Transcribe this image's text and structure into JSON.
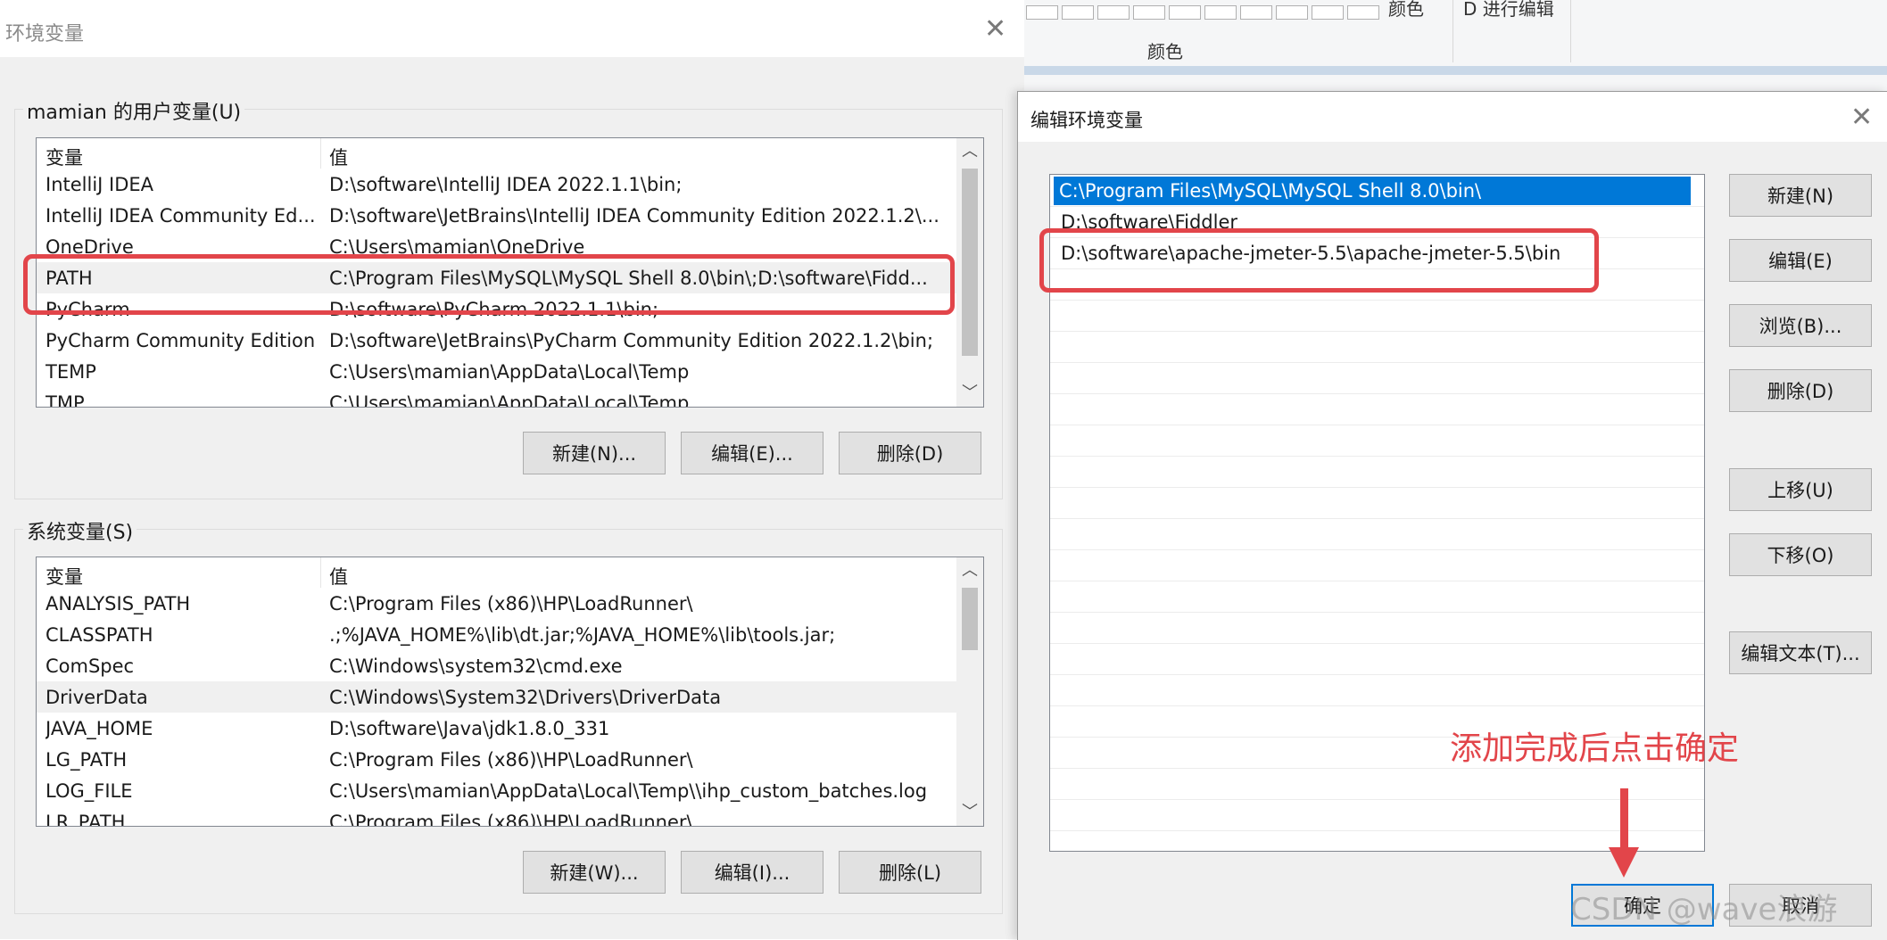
{
  "env_window": {
    "title": "环境变量",
    "close": "✕",
    "user_vars": {
      "label": "mamian 的用户变量(U)",
      "col_var": "变量",
      "col_val": "值",
      "rows": [
        {
          "name": "IntelliJ IDEA",
          "value": "D:\\software\\IntelliJ IDEA 2022.1.1\\bin;"
        },
        {
          "name": "IntelliJ IDEA Community Ed...",
          "value": "D:\\software\\JetBrains\\IntelliJ IDEA Community Edition 2022.1.2\\..."
        },
        {
          "name": "OneDrive",
          "value": "C:\\Users\\mamian\\OneDrive"
        },
        {
          "name": "PATH",
          "value": "C:\\Program Files\\MySQL\\MySQL Shell 8.0\\bin\\;D:\\software\\Fidd..."
        },
        {
          "name": "PyCharm",
          "value": "D:\\software\\PyCharm 2022.1.1\\bin;"
        },
        {
          "name": "PyCharm Community Edition",
          "value": "D:\\software\\JetBrains\\PyCharm Community Edition 2022.1.2\\bin;"
        },
        {
          "name": "TEMP",
          "value": "C:\\Users\\mamian\\AppData\\Local\\Temp"
        },
        {
          "name": "TMP",
          "value": "C:\\Users\\mamian\\AppData\\Local\\Temp"
        }
      ],
      "buttons": {
        "new": "新建(N)...",
        "edit": "编辑(E)...",
        "delete": "删除(D)"
      }
    },
    "system_vars": {
      "label": "系统变量(S)",
      "col_var": "变量",
      "col_val": "值",
      "rows": [
        {
          "name": "ANALYSIS_PATH",
          "value": "C:\\Program Files (x86)\\HP\\LoadRunner\\"
        },
        {
          "name": "CLASSPATH",
          "value": ".;%JAVA_HOME%\\lib\\dt.jar;%JAVA_HOME%\\lib\\tools.jar;"
        },
        {
          "name": "ComSpec",
          "value": "C:\\Windows\\system32\\cmd.exe"
        },
        {
          "name": "DriverData",
          "value": "C:\\Windows\\System32\\Drivers\\DriverData"
        },
        {
          "name": "JAVA_HOME",
          "value": "D:\\software\\Java\\jdk1.8.0_331"
        },
        {
          "name": "LG_PATH",
          "value": "C:\\Program Files (x86)\\HP\\LoadRunner\\"
        },
        {
          "name": "LOG_FILE",
          "value": "C:\\Users\\mamian\\AppData\\Local\\Temp\\\\ihp_custom_batches.log"
        },
        {
          "name": "LR_PATH",
          "value": "C:\\Program Files (x86)\\HP\\LoadRunner\\"
        }
      ],
      "buttons": {
        "new": "新建(W)...",
        "edit": "编辑(I)...",
        "delete": "删除(L)"
      }
    }
  },
  "ribbon": {
    "color_label_top": "颜色",
    "edit_label_top": "D 进行编辑",
    "color_group_label": "颜色"
  },
  "edit_dialog": {
    "title": "编辑环境变量",
    "close": "✕",
    "entries": [
      {
        "text": "C:\\Program Files\\MySQL\\MySQL Shell 8.0\\bin\\",
        "selected": true
      },
      {
        "text": "D:\\software\\Fiddler",
        "selected": false
      },
      {
        "text": "D:\\software\\apache-jmeter-5.5\\apache-jmeter-5.5\\bin",
        "selected": false
      }
    ],
    "buttons": {
      "new": "新建(N)",
      "edit": "编辑(E)",
      "browse": "浏览(B)...",
      "delete": "删除(D)",
      "move_up": "上移(U)",
      "move_down": "下移(O)",
      "edit_text": "编辑文本(T)...",
      "ok": "确定",
      "cancel": "取消"
    }
  },
  "annotation": {
    "text": "添加完成后点击确定",
    "color": "#e2454a"
  },
  "watermark": "CSDN @wave浪游",
  "colors": {
    "selection": "#0078d7",
    "highlight": "#e2454a"
  }
}
